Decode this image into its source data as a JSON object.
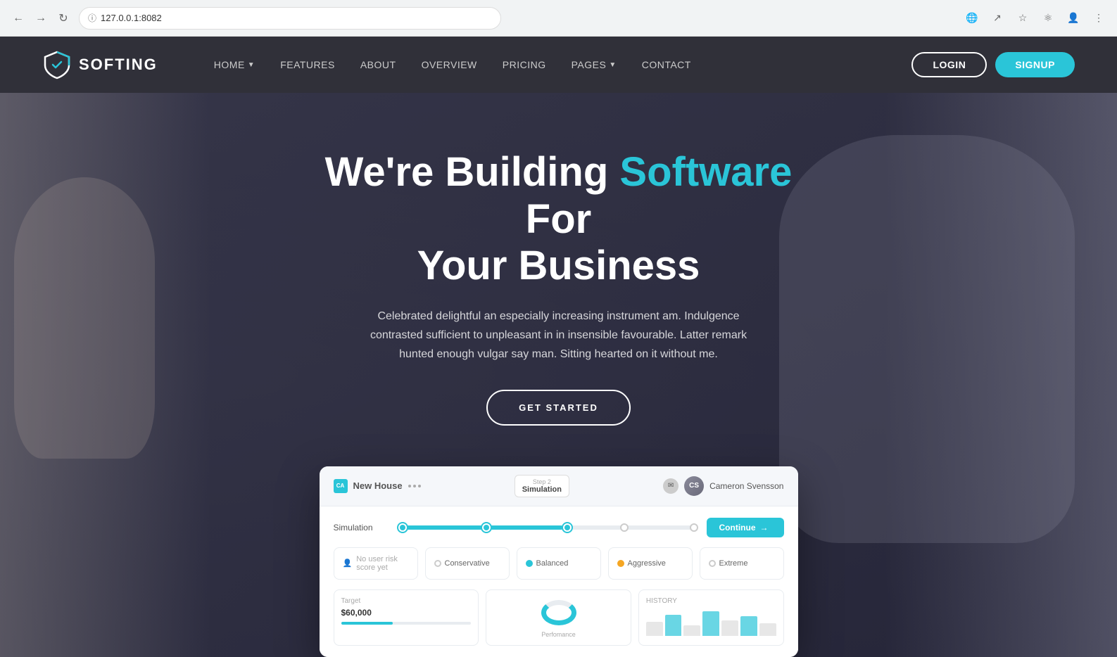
{
  "browser": {
    "url": "127.0.0.1:8082",
    "back_tooltip": "Back",
    "forward_tooltip": "Forward",
    "reload_tooltip": "Reload"
  },
  "navbar": {
    "logo_text": "SOFTING",
    "nav_items": [
      {
        "label": "HOME",
        "has_dropdown": true
      },
      {
        "label": "FEATURES",
        "has_dropdown": false
      },
      {
        "label": "ABOUT",
        "has_dropdown": false
      },
      {
        "label": "OVERVIEW",
        "has_dropdown": false
      },
      {
        "label": "PRICING",
        "has_dropdown": false
      },
      {
        "label": "PAGES",
        "has_dropdown": true
      },
      {
        "label": "CONTACT",
        "has_dropdown": false
      }
    ],
    "login_label": "LOGIN",
    "signup_label": "SIGNUP"
  },
  "hero": {
    "title_part1": "We're Building ",
    "title_accent": "Software",
    "title_part2": " For\nYour Business",
    "subtitle": "Celebrated delightful an especially increasing instrument am. Indulgence contrasted sufficient to unpleasant in in insensible favourable. Latter remark hunted enough vulgar say man. Sitting hearted on it without me.",
    "cta_label": "GET STARTED"
  },
  "dashboard": {
    "brand": "New House",
    "step_label": "Step 2",
    "step_name": "Simulation",
    "user_name": "Cameron Svensson",
    "simulation_label": "Simulation",
    "continue_label": "Continue",
    "no_score_label": "No user risk score yet",
    "options": [
      "Conservative",
      "Balanced",
      "Aggressive",
      "Extreme"
    ],
    "active_option": "Balanced",
    "target_label": "Target",
    "target_value": "$60,000",
    "performance_label": "Perfomance",
    "history_label": "HISTORY"
  }
}
